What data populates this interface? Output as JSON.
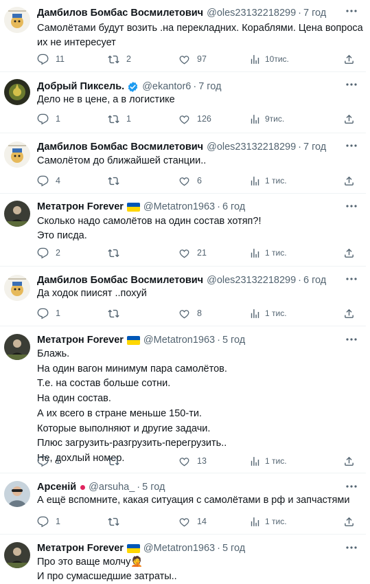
{
  "tweets": [
    {
      "name": "Дамбилов Бомбас Восмилетович",
      "handle": "@oles23132218299",
      "time": "7 год",
      "lines": [
        "Самолётами будут возить .на перекладних. Кораблями. Цена вопроса",
        "их не интересует"
      ],
      "replies": "11",
      "retweets": "2",
      "likes": "97",
      "views": "10тис."
    },
    {
      "name": "Добрый Пиксель.",
      "handle": "@ekantor6",
      "time": "7 год",
      "lines": [
        "Дело не в цене, а в логистике"
      ],
      "replies": "1",
      "retweets": "1",
      "likes": "126",
      "views": "9тис."
    },
    {
      "name": "Дамбилов Бомбас Восмилетович",
      "handle": "@oles23132218299",
      "time": "7 год",
      "lines": [
        "Самолётом до ближайшей станции.."
      ],
      "replies": "4",
      "retweets": "",
      "likes": "6",
      "views": "1 тис."
    },
    {
      "name": "Метатрон Forever",
      "handle": "@Metatron1963",
      "time": "6 год",
      "lines": [
        "Сколько надо самолётов на один состав хотяп?!",
        "Это писда."
      ],
      "replies": "2",
      "retweets": "",
      "likes": "21",
      "views": "1 тис."
    },
    {
      "name": "Дамбилов Бомбас Восмилетович",
      "handle": "@oles23132218299",
      "time": "6 год",
      "lines": [
        "Да ходок пиисят ..похуй"
      ],
      "replies": "1",
      "retweets": "",
      "likes": "8",
      "views": "1 тис."
    },
    {
      "name": "Метатрон Forever",
      "handle": "@Metatron1963",
      "time": "5 год",
      "lines": [
        "Блажь.",
        "На один вагон минимум пара самолётов.",
        "Т.е. на состав больше сотни.",
        "На один состав.",
        "А их всего в стране меньше 150-ти.",
        "Которые выполняют и другие задачи.",
        "Плюс загрузить-разгрузить-перегрузить..",
        "Не, дохлый номер."
      ],
      "replies": "1",
      "retweets": "",
      "likes": "13",
      "views": "1 тис."
    },
    {
      "name": "Арсеній",
      "handle": "@arsuha_",
      "time": "5 год",
      "lines": [
        "А ещё вспомните, какая ситуация с самолётами в рф и запчастями"
      ],
      "replies": "1",
      "retweets": "",
      "likes": "14",
      "views": "1 тис."
    },
    {
      "name": "Метатрон Forever",
      "handle": "@Metatron1963",
      "time": "5 год",
      "lines": [
        "Про это ваще молчу🤦",
        "И про сумасшедшие затраты.."
      ],
      "replies": "",
      "retweets": "",
      "likes": "",
      "views": ""
    }
  ],
  "icons": {
    "reply": "reply-icon",
    "retweet": "retweet-icon",
    "like": "heart-icon",
    "views": "views-chart-icon",
    "share": "share-icon",
    "more": "more-dots-icon",
    "verified": "verified-badge-icon",
    "flag": "ukraine-flag-icon"
  },
  "colors": {
    "text": "#0f1419",
    "secondary": "#536471",
    "verified": "#1d9bf0",
    "flag_blue": "#0057b7",
    "flag_yellow": "#ffd700",
    "status_dot": "#e0245e",
    "separator": "#eff3f4"
  }
}
